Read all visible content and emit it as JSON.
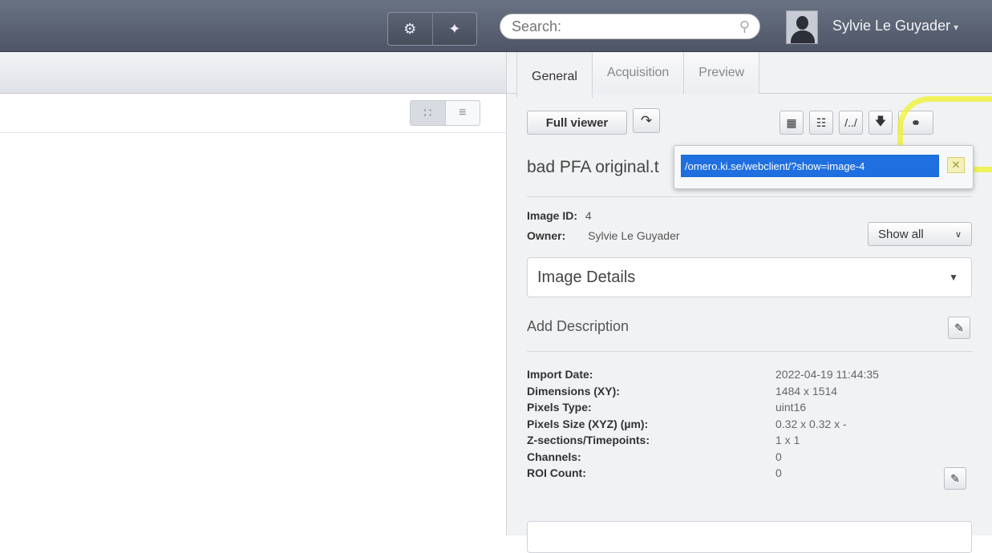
{
  "topbar": {
    "tools": [
      {
        "icon": "gears-icon",
        "glyph": "⚙"
      },
      {
        "icon": "user-group-icon",
        "glyph": "✦"
      }
    ],
    "search": {
      "placeholder": "Search:"
    },
    "user_name": "Sylvie Le Guyader"
  },
  "tabs": [
    "General",
    "Acquisition",
    "Preview"
  ],
  "toolbar": {
    "full_viewer": "Full viewer"
  },
  "image": {
    "name": "bad PFA original.t",
    "link": "/omero.ki.se/webclient/?show=image-4",
    "id_label": "Image ID:",
    "id_value": "4",
    "owner_label": "Owner:",
    "owner_value": "Sylvie Le Guyader"
  },
  "show_all": "Show all",
  "image_details_label": "Image Details",
  "add_description": "Add Description",
  "details": [
    {
      "k": "Import Date:",
      "v": "2022-04-19 11:44:35"
    },
    {
      "k": "Dimensions (XY):",
      "v": "1484 x 1514"
    },
    {
      "k": "Pixels Type:",
      "v": "uint16"
    },
    {
      "k": "Pixels Size (XYZ) (µm):",
      "v": "0.32 x 0.32 x -"
    },
    {
      "k": "Z-sections/Timepoints:",
      "v": "1 x 1"
    },
    {
      "k": "Channels:",
      "v": "0"
    },
    {
      "k": "ROI Count:",
      "v": "0"
    }
  ],
  "colors": {
    "highlight": "#eef228",
    "selection": "#1f6fe0",
    "topbar": "#5b6374"
  }
}
